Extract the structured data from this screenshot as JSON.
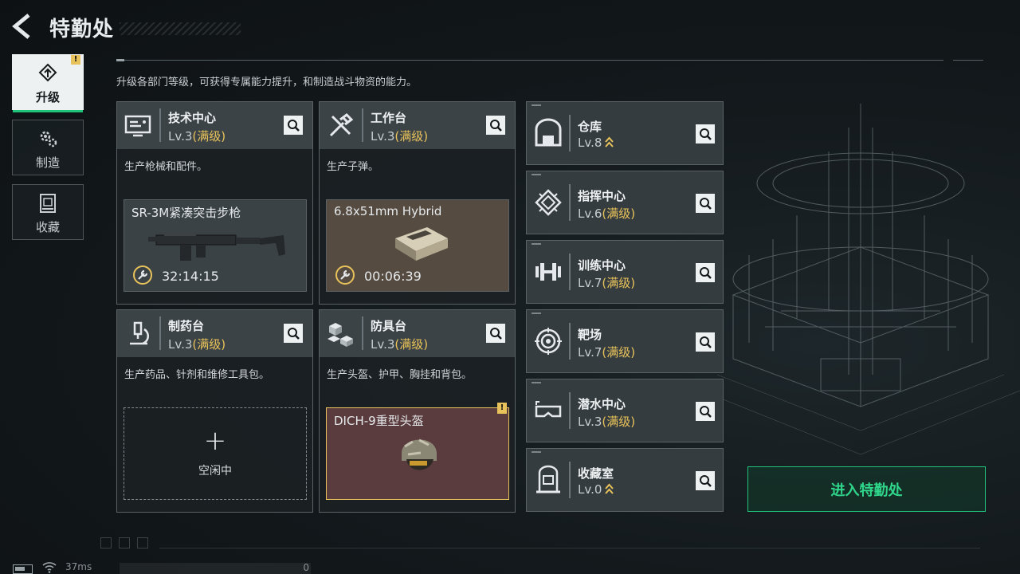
{
  "header": {
    "title": "特勤处"
  },
  "description": "升级各部门等级，可获得专属能力提升，和制造战斗物资的能力。",
  "nav": [
    {
      "label": "升级",
      "icon": "upgrade-icon",
      "active": true,
      "warning": "!"
    },
    {
      "label": "制造",
      "icon": "gear-icon",
      "active": false
    },
    {
      "label": "收藏",
      "icon": "collection-icon",
      "active": false
    }
  ],
  "cards": {
    "tech": {
      "name": "技术中心",
      "level": "Lv.3",
      "maxed": "(满级)",
      "desc": "生产枪械和配件。",
      "product": "SR-3M紧凑突击步枪",
      "timer": "32:14:15",
      "icon": "monitor-icon"
    },
    "workbench": {
      "name": "工作台",
      "level": "Lv.3",
      "maxed": "(满级)",
      "desc": "生产子弹。",
      "product": "6.8x51mm Hybrid",
      "timer": "00:06:39",
      "icon": "tools-icon"
    },
    "pharmacy": {
      "name": "制药台",
      "level": "Lv.3",
      "maxed": "(满级)",
      "desc": "生产药品、针剂和维修工具包。",
      "idle_label": "空闲中",
      "plus": "+",
      "icon": "microscope-icon"
    },
    "armor": {
      "name": "防具台",
      "level": "Lv.3",
      "maxed": "(满级)",
      "desc": "生产头盔、护甲、胸挂和背包。",
      "product": "DICH-9重型头盔",
      "warning": "!",
      "icon": "cubes-icon"
    }
  },
  "facilities": [
    {
      "name": "仓库",
      "level": "Lv.8",
      "maxed": "",
      "upgradable": true,
      "icon": "warehouse-icon"
    },
    {
      "name": "指挥中心",
      "level": "Lv.6",
      "maxed": "(满级)",
      "upgradable": false,
      "icon": "chip-icon"
    },
    {
      "name": "训练中心",
      "level": "Lv.7",
      "maxed": "(满级)",
      "upgradable": false,
      "icon": "dumbbell-icon"
    },
    {
      "name": "靶场",
      "level": "Lv.7",
      "maxed": "(满级)",
      "upgradable": false,
      "icon": "target-icon"
    },
    {
      "name": "潜水中心",
      "level": "Lv.3",
      "maxed": "(满级)",
      "upgradable": false,
      "icon": "diving-mask-icon"
    },
    {
      "name": "收藏室",
      "level": "Lv.0",
      "maxed": "",
      "upgradable": true,
      "icon": "vault-icon"
    }
  ],
  "enter_button": "进入特勤处",
  "status": {
    "ping": "37ms",
    "counter": "0"
  },
  "colors": {
    "accent_green": "#1fc47a",
    "maxed_gold": "#e8c25a",
    "card_header": "#3c4347"
  }
}
